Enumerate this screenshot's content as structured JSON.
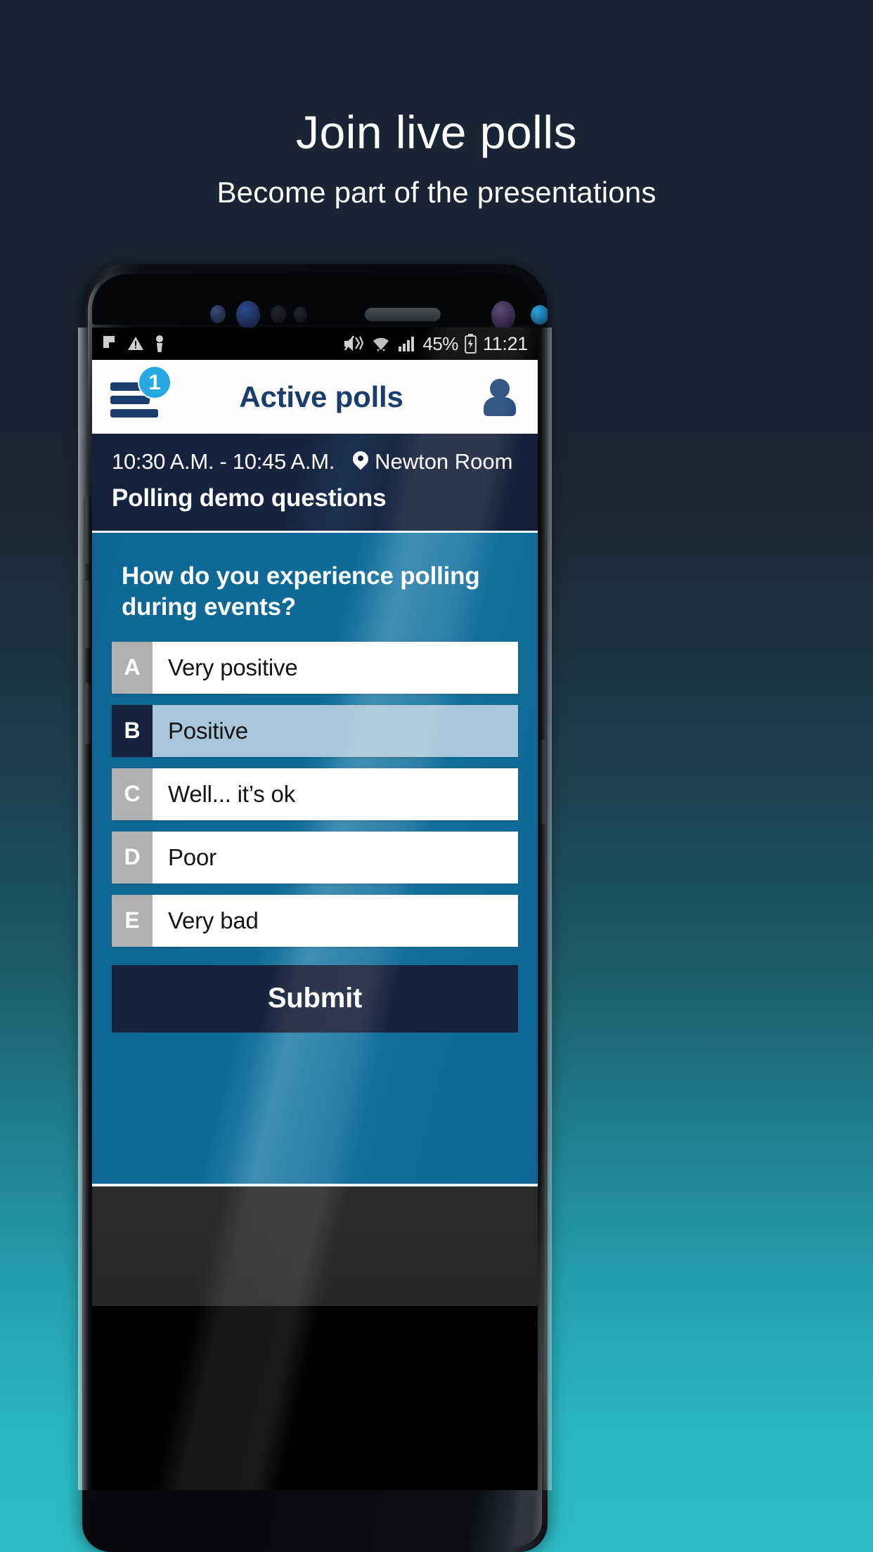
{
  "promo": {
    "title": "Join live polls",
    "subtitle": "Become part of the presentations"
  },
  "status_bar": {
    "icons_left": [
      "flag-icon",
      "warning-triangle-icon",
      "person-pin-icon"
    ],
    "mute_icon": "volume-mute-icon",
    "wifi_icon": "wifi-icon",
    "signal_icon": "cellular-signal-icon",
    "battery_percent": "45%",
    "battery_icon": "battery-charging-icon",
    "time": "11:21"
  },
  "app_header": {
    "menu_icon": "hamburger-menu-icon",
    "menu_badge": "1",
    "title": "Active polls",
    "avatar_icon": "person-avatar-icon"
  },
  "session": {
    "time_range": "10:30 A.M. - 10:45 A.M.",
    "location_icon": "location-pin-icon",
    "location": "Newton Room",
    "title": "Polling demo questions"
  },
  "poll": {
    "question": "How do you experience polling during events?",
    "options": [
      {
        "letter": "A",
        "label": "Very positive",
        "selected": false
      },
      {
        "letter": "B",
        "label": "Positive",
        "selected": true
      },
      {
        "letter": "C",
        "label": "Well... it’s ok",
        "selected": false
      },
      {
        "letter": "D",
        "label": "Poor",
        "selected": false
      },
      {
        "letter": "E",
        "label": "Very bad",
        "selected": false
      }
    ],
    "submit_label": "Submit"
  },
  "colors": {
    "page_top": "#1b2434",
    "page_bottom": "#2dbdc6",
    "brand_navy": "#1a3d6b",
    "badge_blue": "#27a8e0",
    "poll_blue": "#0f6a97",
    "selected_bg": "#a9c5d9",
    "selected_letter_bg": "#17233c",
    "letter_bg": "#b1b1b1",
    "submit_bg": "#17233c"
  }
}
